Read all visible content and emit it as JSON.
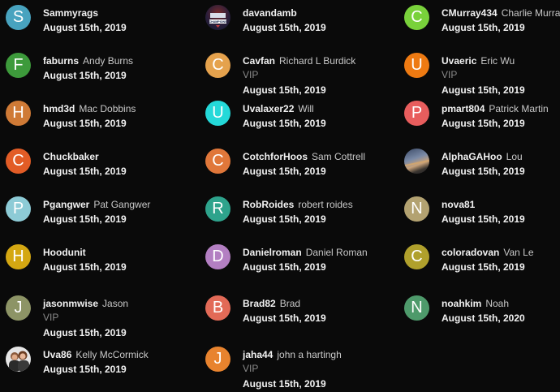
{
  "columns": [
    [
      {
        "initial": "S",
        "color": "#48a3bf",
        "username": "Sammyrags",
        "fullname": "",
        "vip": "",
        "date": "August 15th, 2019",
        "avatar": "letter"
      },
      {
        "initial": "F",
        "color": "#3d9a3b",
        "username": "faburns",
        "fullname": "Andy Burns",
        "vip": "",
        "date": "August 15th, 2019",
        "avatar": "letter"
      },
      {
        "initial": "H",
        "color": "#cf7a36",
        "username": "hmd3d",
        "fullname": "Mac Dobbins",
        "vip": "",
        "date": "August 15th, 2019",
        "avatar": "letter"
      },
      {
        "initial": "C",
        "color": "#e25c26",
        "username": "Chuckbaker",
        "fullname": "",
        "vip": "",
        "date": "August 15th, 2019",
        "avatar": "letter"
      },
      {
        "initial": "P",
        "color": "#8dcbd6",
        "username": "Pgangwer",
        "fullname": "Pat Gangwer",
        "vip": "",
        "date": "August 15th, 2019",
        "avatar": "letter"
      },
      {
        "initial": "H",
        "color": "#d4a712",
        "username": "Hoodunit",
        "fullname": "",
        "vip": "",
        "date": "August 15th, 2019",
        "avatar": "letter"
      },
      {
        "initial": "J",
        "color": "#8d9466",
        "username": "jasonmwise",
        "fullname": "Jason",
        "vip": "VIP",
        "date": "August 15th, 2019",
        "avatar": "letter"
      },
      {
        "initial": "",
        "color": "#d9d9d9",
        "username": "Uva86",
        "fullname": "Kelly McCormick",
        "vip": "",
        "date": "August 15th, 2019",
        "avatar": "photo-couple"
      }
    ],
    [
      {
        "initial": "",
        "color": "#1c2a4a",
        "username": "davandamb",
        "fullname": "",
        "vip": "",
        "date": "August 15th, 2019",
        "avatar": "champions-logo",
        "logo_text": "CHAMPIONS"
      },
      {
        "initial": "C",
        "color": "#e5a24d",
        "username": "Cavfan",
        "fullname": "Richard L Burdick",
        "vip": "VIP",
        "date": "August 15th, 2019",
        "avatar": "letter"
      },
      {
        "initial": "U",
        "color": "#24d9d9",
        "username": "Uvalaxer22",
        "fullname": "Will",
        "vip": "",
        "date": "August 15th, 2019",
        "avatar": "letter"
      },
      {
        "initial": "C",
        "color": "#e0773a",
        "username": "CotchforHoos",
        "fullname": "Sam Cottrell",
        "vip": "",
        "date": "August 15th, 2019",
        "avatar": "letter"
      },
      {
        "initial": "R",
        "color": "#2ea38c",
        "username": "RobRoides",
        "fullname": "robert roides",
        "vip": "",
        "date": "August 15th, 2019",
        "avatar": "letter"
      },
      {
        "initial": "D",
        "color": "#b37fc2",
        "username": "Danielroman",
        "fullname": "Daniel Roman",
        "vip": "",
        "date": "August 15th, 2019",
        "avatar": "letter"
      },
      {
        "initial": "B",
        "color": "#e26a57",
        "username": "Brad82",
        "fullname": "Brad",
        "vip": "",
        "date": "August 15th, 2019",
        "avatar": "letter"
      },
      {
        "initial": "J",
        "color": "#e8832e",
        "username": "jaha44",
        "fullname": "john a hartingh",
        "vip": "VIP",
        "date": "August 15th, 2019",
        "avatar": "letter"
      }
    ],
    [
      {
        "initial": "C",
        "color": "#79d13b",
        "username": "CMurray434",
        "fullname": "Charlie Murray",
        "vip": "",
        "date": "August 15th, 2019",
        "avatar": "letter"
      },
      {
        "initial": "U",
        "color": "#ee7a12",
        "username": "Uvaeric",
        "fullname": "Eric Wu",
        "vip": "VIP",
        "date": "August 15th, 2019",
        "avatar": "letter"
      },
      {
        "initial": "P",
        "color": "#e85d5d",
        "username": "pmart804",
        "fullname": "Patrick Martin",
        "vip": "",
        "date": "August 15th, 2019",
        "avatar": "letter"
      },
      {
        "initial": "",
        "color": "#5d6f8a",
        "username": "AlphaGAHoo",
        "fullname": "Lou",
        "vip": "",
        "date": "August 15th, 2019",
        "avatar": "photo-landscape"
      },
      {
        "initial": "N",
        "color": "#b3a271",
        "username": "nova81",
        "fullname": "",
        "vip": "",
        "date": "August 15th, 2019",
        "avatar": "letter"
      },
      {
        "initial": "C",
        "color": "#b0a02c",
        "username": "coloradovan",
        "fullname": "Van Le",
        "vip": "",
        "date": "August 15th, 2019",
        "avatar": "letter"
      },
      {
        "initial": "N",
        "color": "#4e9a6b",
        "username": "noahkim",
        "fullname": "Noah",
        "vip": "",
        "date": "August 15th, 2020",
        "avatar": "letter"
      }
    ]
  ]
}
